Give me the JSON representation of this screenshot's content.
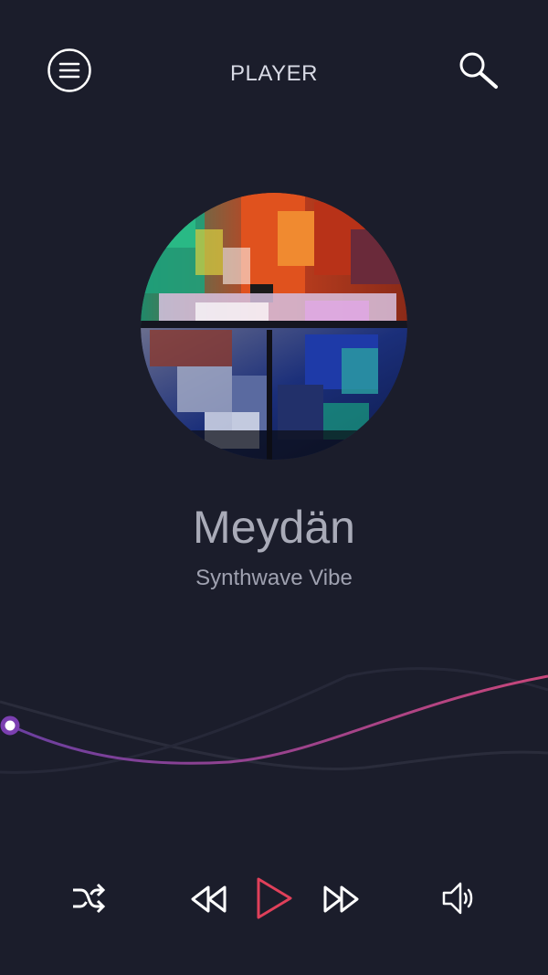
{
  "header": {
    "title": "PLAYER",
    "menu_icon": "hamburger-menu-icon",
    "search_icon": "search-icon"
  },
  "track": {
    "title": "Meydän",
    "artist": "Synthwave Vibe"
  },
  "progress": {
    "fraction": 0.02
  },
  "controls": {
    "shuffle_icon": "shuffle-icon",
    "previous_icon": "rewind-icon",
    "play_icon": "play-icon",
    "next_icon": "fast-forward-icon",
    "volume_icon": "volume-icon"
  },
  "colors": {
    "background": "#1b1d2b",
    "accent_start": "#6a3fa0",
    "accent_end": "#c8467a",
    "play": "#e0405a"
  }
}
